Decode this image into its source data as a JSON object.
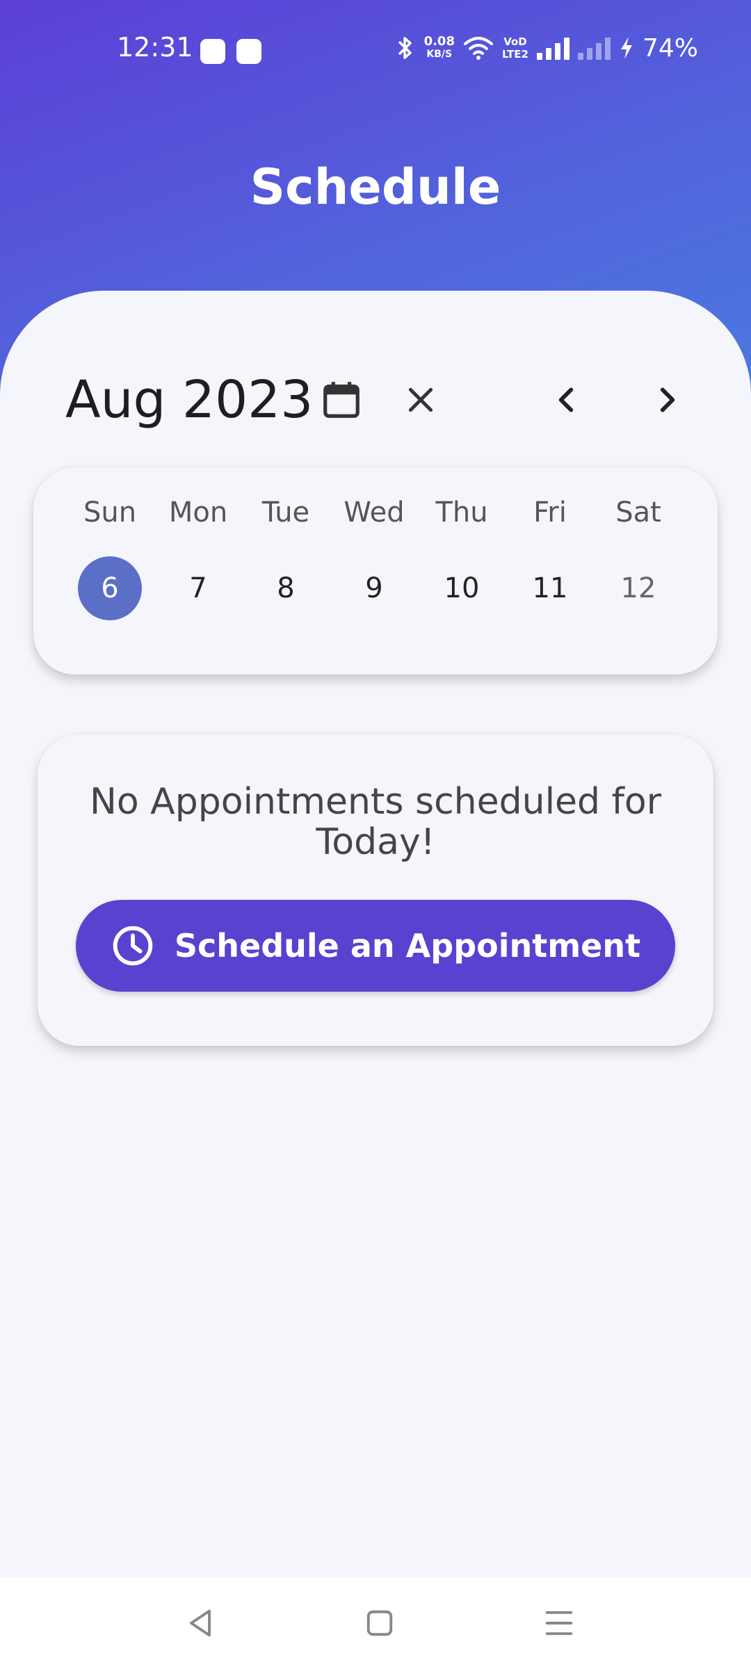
{
  "status_bar": {
    "time": "12:31",
    "net_speed_value": "0.08",
    "net_speed_unit": "KB/S",
    "network_label_top": "VoD",
    "network_label_bottom": "LTE2",
    "battery": "74%"
  },
  "header": {
    "title": "Schedule"
  },
  "calendar": {
    "month_label": "Aug 2023",
    "days": [
      {
        "name": "Sun",
        "number": "6",
        "selected": true
      },
      {
        "name": "Mon",
        "number": "7"
      },
      {
        "name": "Tue",
        "number": "8"
      },
      {
        "name": "Wed",
        "number": "9"
      },
      {
        "name": "Thu",
        "number": "10"
      },
      {
        "name": "Fri",
        "number": "11"
      },
      {
        "name": "Sat",
        "number": "12"
      }
    ]
  },
  "appointments": {
    "empty_message": "No Appointments scheduled for Today!",
    "schedule_button_label": "Schedule an Appointment"
  },
  "colors": {
    "header_gradient_start": "#5c3fd6",
    "header_gradient_end": "#4b7ae0",
    "primary_button": "#5b41cf",
    "selected_day": "#5b6fc7",
    "background": "#f5f6fb"
  },
  "icons": {
    "calendar": "calendar-icon",
    "close": "close-icon",
    "prev": "chevron-left-icon",
    "next": "chevron-right-icon",
    "clock": "clock-icon"
  }
}
